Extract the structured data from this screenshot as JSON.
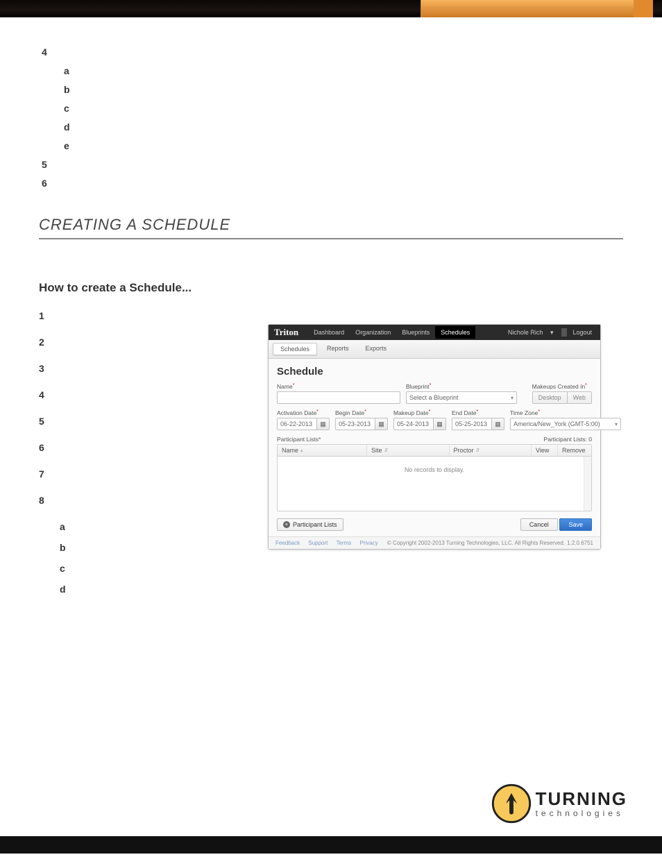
{
  "upper_list": {
    "start": "4",
    "items": [
      "a",
      "b",
      "c",
      "d",
      "e"
    ],
    "after": [
      "5",
      "6"
    ]
  },
  "section_title": "CREATING A SCHEDULE",
  "howto_title": "How to create a Schedule...",
  "steps": [
    "1",
    "2",
    "3",
    "4",
    "5",
    "6",
    "7",
    "8"
  ],
  "substeps": [
    "a",
    "b",
    "c",
    "d"
  ],
  "shot": {
    "brand": "Triton",
    "nav": {
      "items": [
        "Dashboard",
        "Organization",
        "Blueprints",
        "Schedules"
      ],
      "active": "Schedules"
    },
    "user": "Nichole Rich",
    "logout": "Logout",
    "subnav": {
      "items": [
        "Schedules",
        "Reports",
        "Exports"
      ],
      "active": "Schedules"
    },
    "heading": "Schedule",
    "fields": {
      "name_label": "Name",
      "blueprint_label": "Blueprint",
      "blueprint_value": "Select a Blueprint",
      "makeups_label": "Makeups Created In",
      "seg1": "Desktop",
      "seg2": "Web",
      "activation_label": "Activation Date",
      "activation": "06-22-2013",
      "begin_label": "Begin Date",
      "begin": "05-23-2013",
      "makeup_label": "Makeup Date",
      "makeup": "05-24-2013",
      "end_label": "End Date",
      "end": "05-25-2013",
      "tz_label": "Time Zone",
      "tz": "America/New_York (GMT-5:00)"
    },
    "plist_label": "Participant Lists",
    "plist_count": "Participant Lists: 0",
    "grid": {
      "cols": [
        "Name",
        "Site",
        "Proctor",
        "View",
        "Remove"
      ],
      "empty": "No records to display."
    },
    "pl_btn": "Participant Lists",
    "cancel": "Cancel",
    "save": "Save",
    "footer_links": [
      "Feedback",
      "Support",
      "Terms",
      "Privacy"
    ],
    "copyright": "© Copyright 2002-2013 Turning Technologies, LLC. All Rights Reserved.",
    "version": "1.2.0.6751"
  },
  "logo": {
    "big": "TURNING",
    "small": "technologies"
  }
}
